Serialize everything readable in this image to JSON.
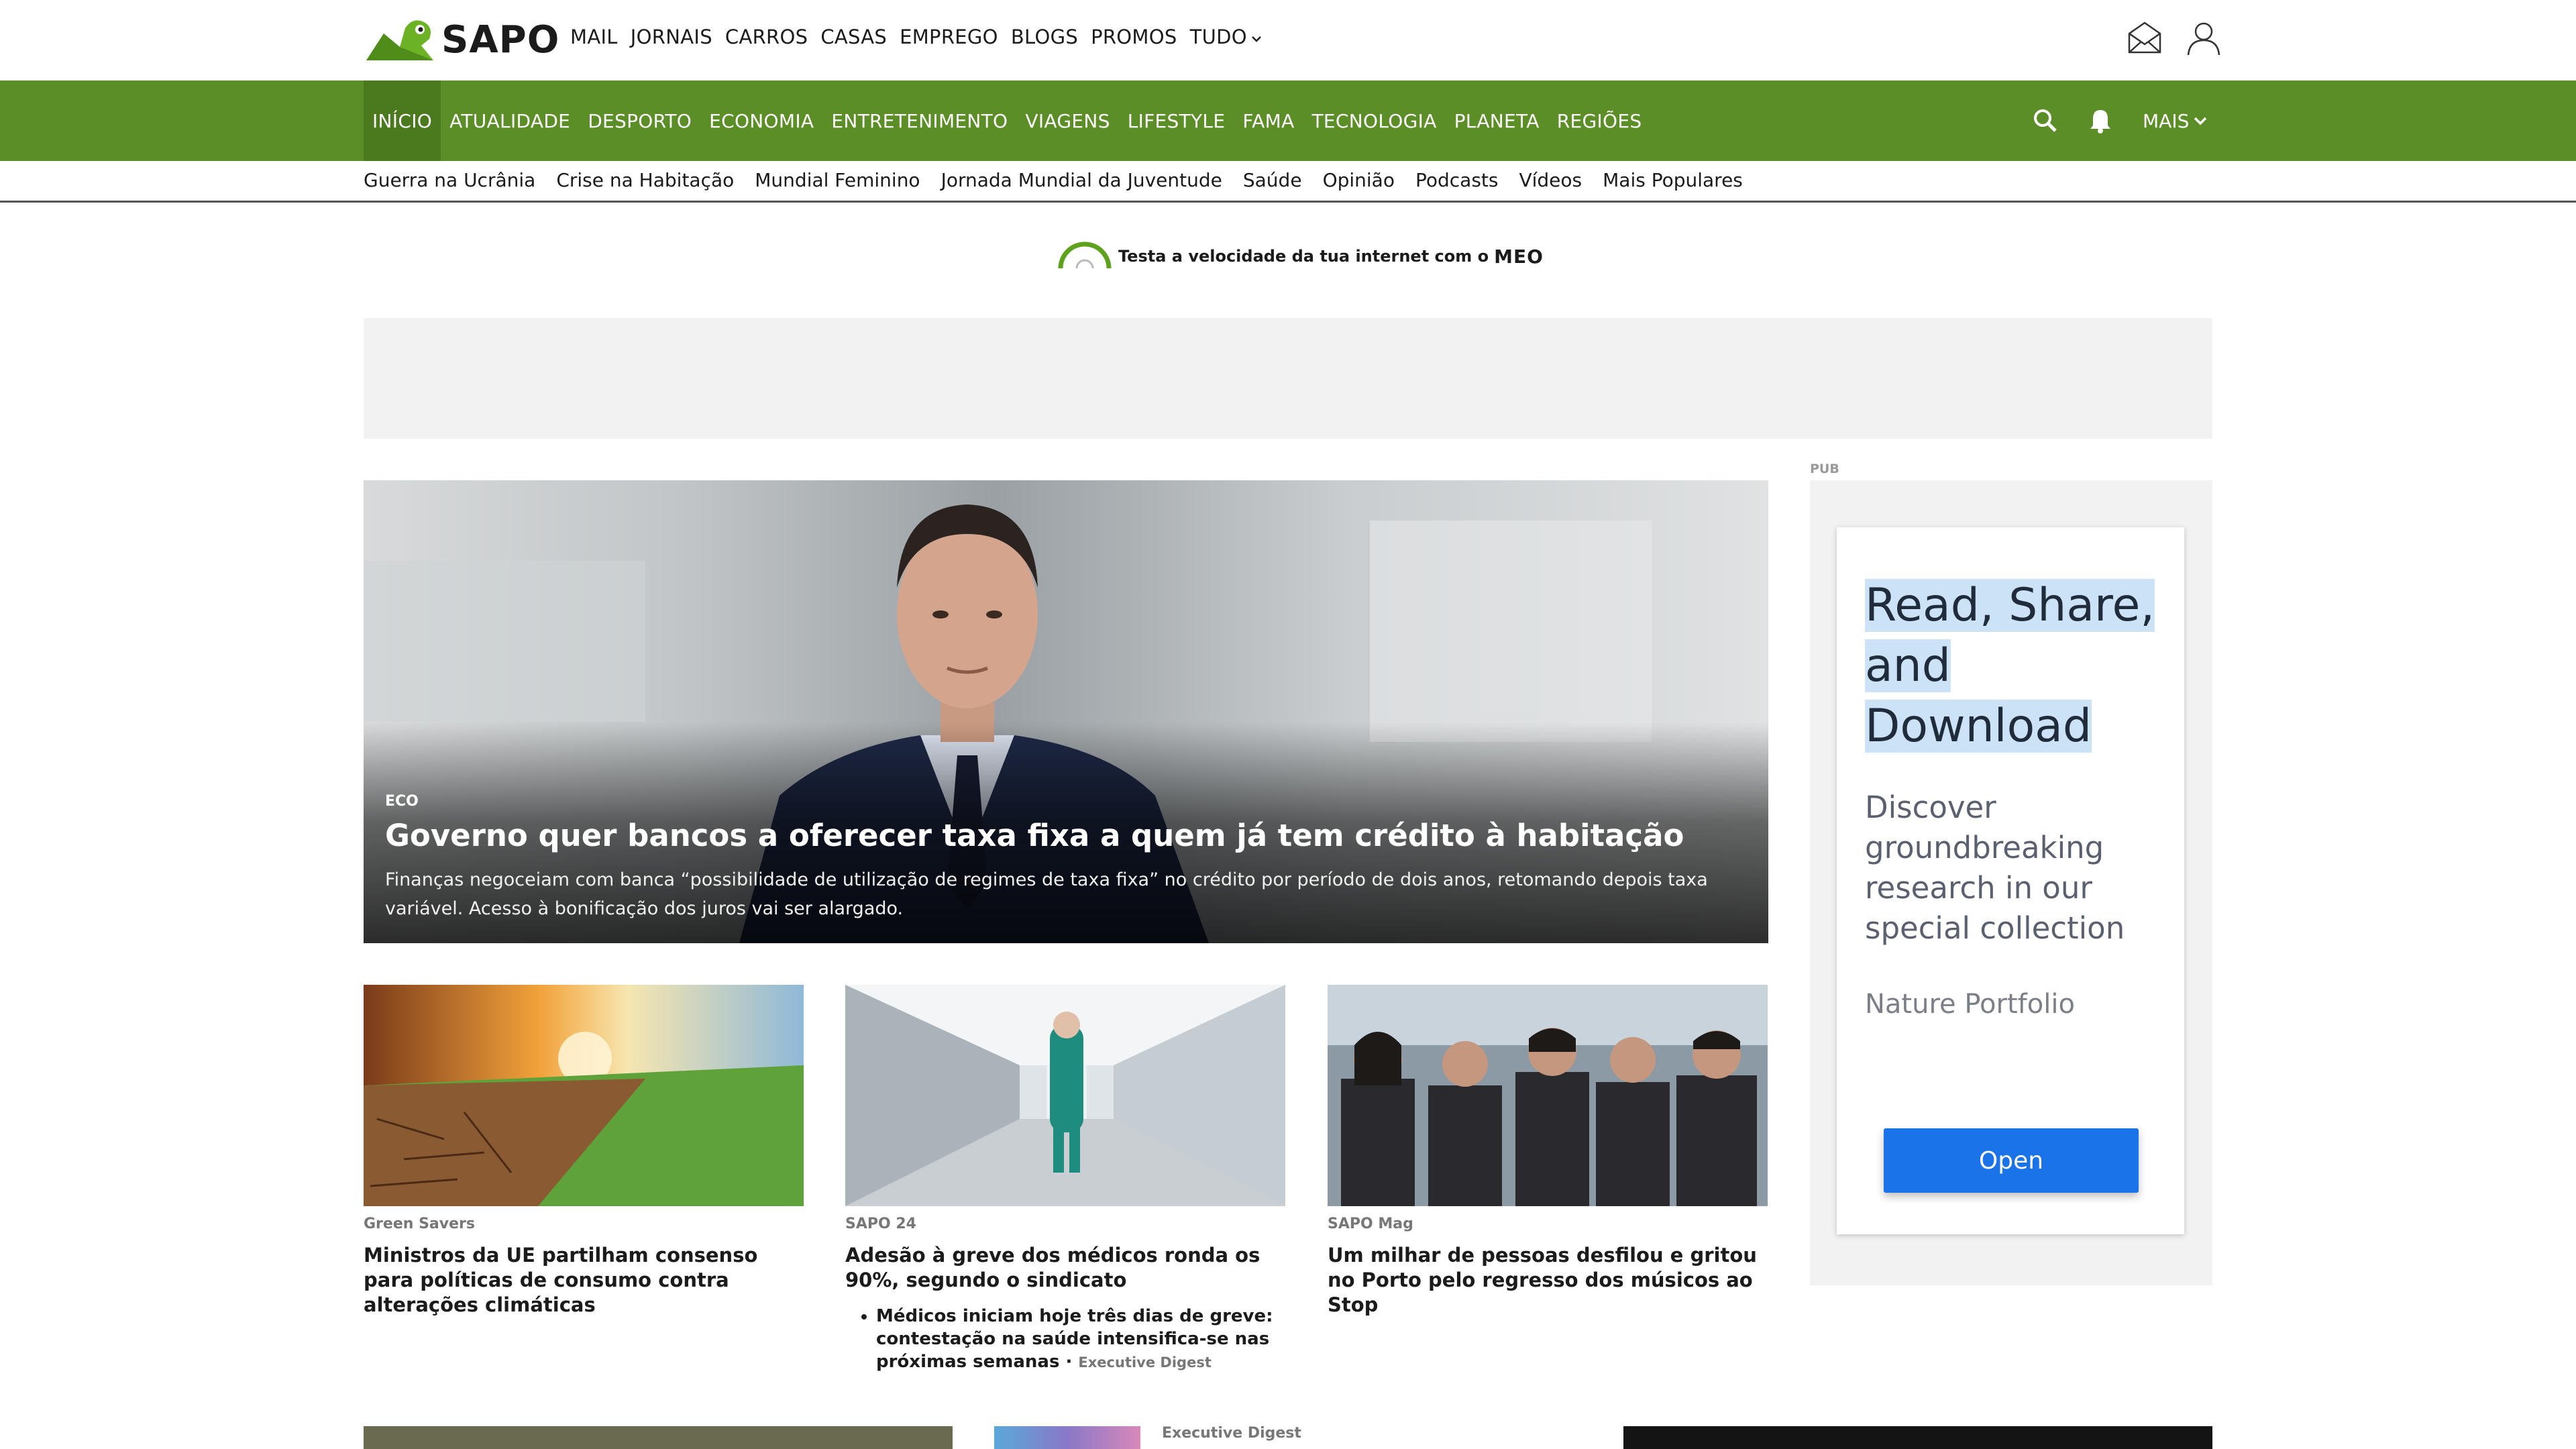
{
  "brand": {
    "logo_text": "SAPO"
  },
  "topnav": [
    "MAIL",
    "JORNAIS",
    "CARROS",
    "CASAS",
    "EMPREGO",
    "BLOGS",
    "PROMOS",
    "TUDO"
  ],
  "mainnav": {
    "items": [
      "INÍCIO",
      "ATUALIDADE",
      "DESPORTO",
      "ECONOMIA",
      "ENTRETENIMENTO",
      "VIAGENS",
      "LIFESTYLE",
      "FAMA",
      "TECNOLOGIA",
      "PLANETA",
      "REGIÕES"
    ],
    "more_label": "MAIS",
    "accent": "#5b8e26"
  },
  "subnav": [
    "Guerra na Ucrânia",
    "Crise na Habitação",
    "Mundial Feminino",
    "Jornada Mundial da Juventude",
    "Saúde",
    "Opinião",
    "Podcasts",
    "Vídeos",
    "Mais Populares"
  ],
  "speedtest": {
    "text": "Testa a velocidade da tua internet com o",
    "brand": "MEO"
  },
  "hero": {
    "kicker": "ECO",
    "headline": "Governo quer bancos a oferecer taxa fixa a quem já tem crédito à habitação",
    "lede": "Finanças negoceiam com banca “possibilidade de utilização de regimes de taxa fixa” no crédito por período de dois anos, retomando depois taxa variável. Acesso à bonificação dos juros vai ser alargado."
  },
  "cards": [
    {
      "source": "Green Savers",
      "title": "Ministros da UE partilham consenso para políticas de consumo contra alterações climáticas"
    },
    {
      "source": "SAPO 24",
      "title": "Adesão à greve dos médicos ronda os 90%, segundo o sindicato",
      "related": {
        "text": "Médicos iniciam hoje três dias de greve: contestação na saúde intensifica-se nas próximas semanas",
        "source": "Executive Digest"
      }
    },
    {
      "source": "SAPO Mag",
      "title": "Um milhar de pessoas desfilou e gritou no Porto pelo regresso dos músicos ao Stop"
    }
  ],
  "pub": {
    "label": "PUB"
  },
  "ad": {
    "headline": "Read, Share, and Download",
    "sub": "Discover groundbreaking research in our special collection",
    "brand": "Nature Portfolio",
    "button": "Open"
  },
  "bottom": {
    "source": "Executive Digest"
  }
}
